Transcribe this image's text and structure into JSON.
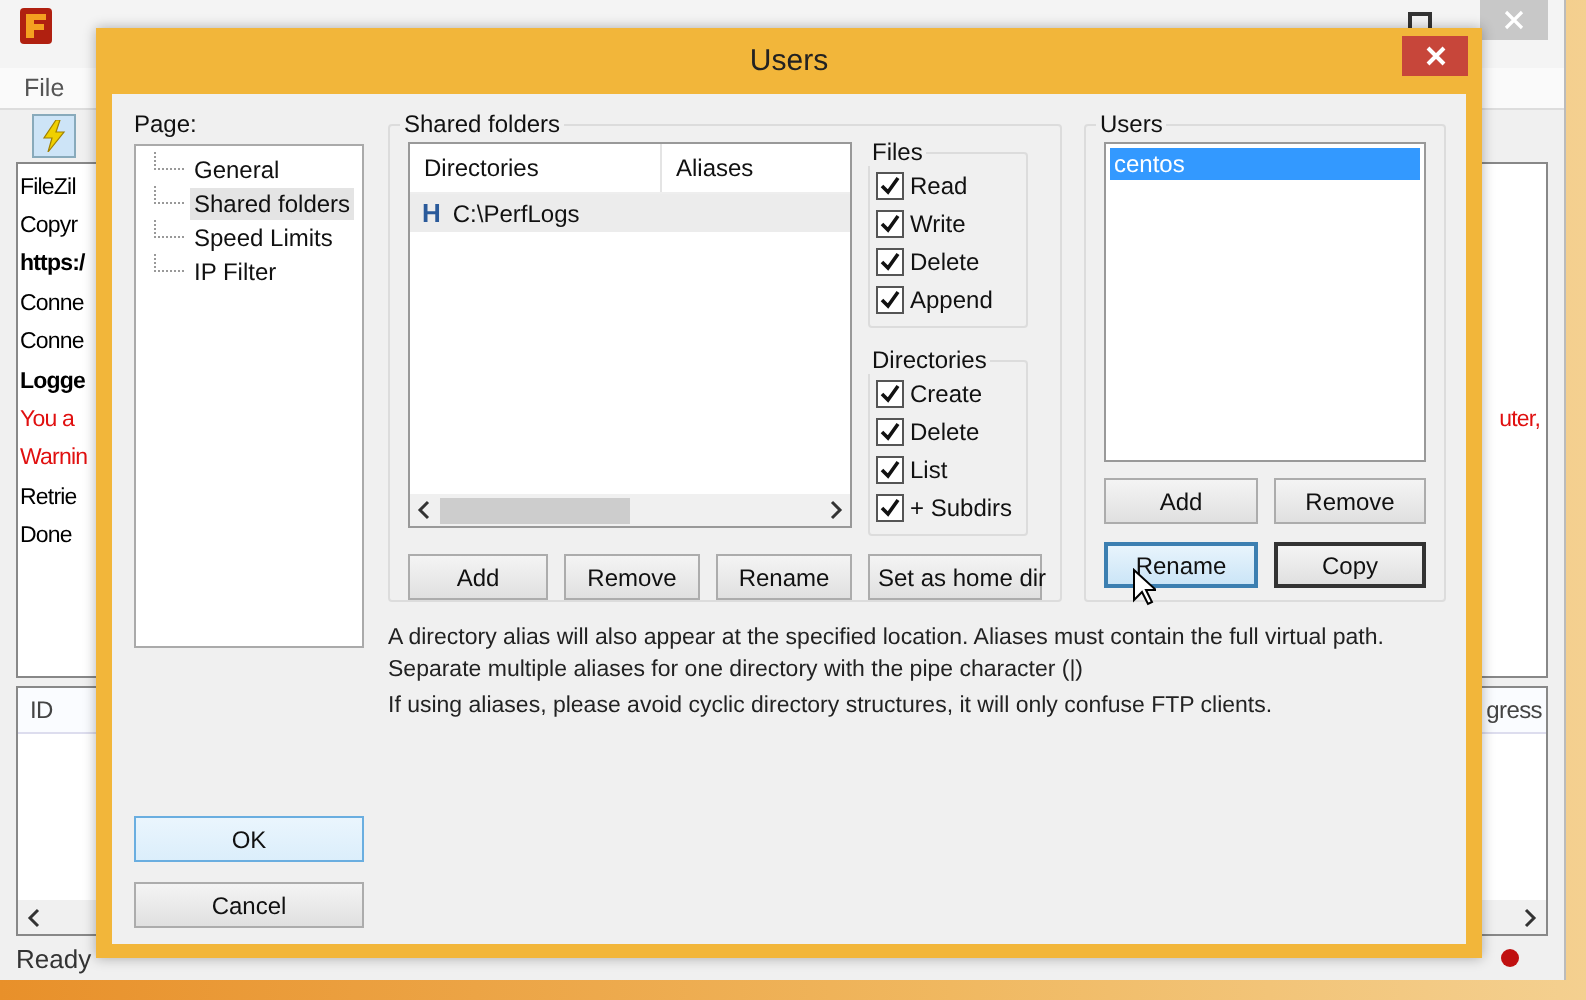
{
  "main_window": {
    "menu": [
      "File"
    ],
    "log_lines": [
      {
        "text": "FileZil",
        "kind": "normal"
      },
      {
        "text": "Copyr",
        "kind": "normal"
      },
      {
        "text": "https:/",
        "kind": "bold"
      },
      {
        "text": "Conne",
        "kind": "normal"
      },
      {
        "text": "Conne",
        "kind": "normal"
      },
      {
        "text": "Logge",
        "kind": "bold"
      },
      {
        "text": "You a",
        "kind": "error",
        "tail": "uter,"
      },
      {
        "text": "Warnin",
        "kind": "error"
      },
      {
        "text": "Retrie",
        "kind": "normal"
      },
      {
        "text": "Done",
        "kind": "normal"
      }
    ],
    "queue_columns": [
      "ID",
      "gress"
    ],
    "status": "Ready"
  },
  "dialog": {
    "title": "Users",
    "page_label": "Page:",
    "pages": [
      {
        "label": "General",
        "selected": false
      },
      {
        "label": "Shared folders",
        "selected": true
      },
      {
        "label": "Speed Limits",
        "selected": false
      },
      {
        "label": "IP Filter",
        "selected": false
      }
    ],
    "shared_folders": {
      "title": "Shared folders",
      "columns": [
        "Directories",
        "Aliases"
      ],
      "rows": [
        {
          "marker": "H",
          "directory": "C:\\PerfLogs",
          "selected": true
        }
      ],
      "buttons": [
        "Add",
        "Remove",
        "Rename",
        "Set as home dir"
      ]
    },
    "files": {
      "title": "Files",
      "options": [
        {
          "label": "Read",
          "checked": true
        },
        {
          "label": "Write",
          "checked": true
        },
        {
          "label": "Delete",
          "checked": true
        },
        {
          "label": "Append",
          "checked": true
        }
      ]
    },
    "directories": {
      "title": "Directories",
      "options": [
        {
          "label": "Create",
          "checked": true
        },
        {
          "label": "Delete",
          "checked": true
        },
        {
          "label": "List",
          "checked": true
        },
        {
          "label": "+ Subdirs",
          "checked": true
        }
      ]
    },
    "users": {
      "title": "Users",
      "items": [
        {
          "name": "centos",
          "selected": true
        }
      ],
      "buttons": [
        {
          "label": "Add",
          "hovered": false,
          "default": false
        },
        {
          "label": "Remove",
          "hovered": false,
          "default": false
        },
        {
          "label": "Rename",
          "hovered": true,
          "default": false
        },
        {
          "label": "Copy",
          "hovered": false,
          "default": true
        }
      ]
    },
    "help": [
      "A directory alias will also appear at the specified location. Aliases must contain the full virtual path. Separate multiple aliases for one directory with the pipe character (|)",
      "If using aliases, please avoid cyclic directory structures, it will only confuse FTP clients."
    ],
    "buttons": [
      {
        "label": "OK",
        "focused": true
      },
      {
        "label": "Cancel",
        "focused": false
      }
    ]
  }
}
